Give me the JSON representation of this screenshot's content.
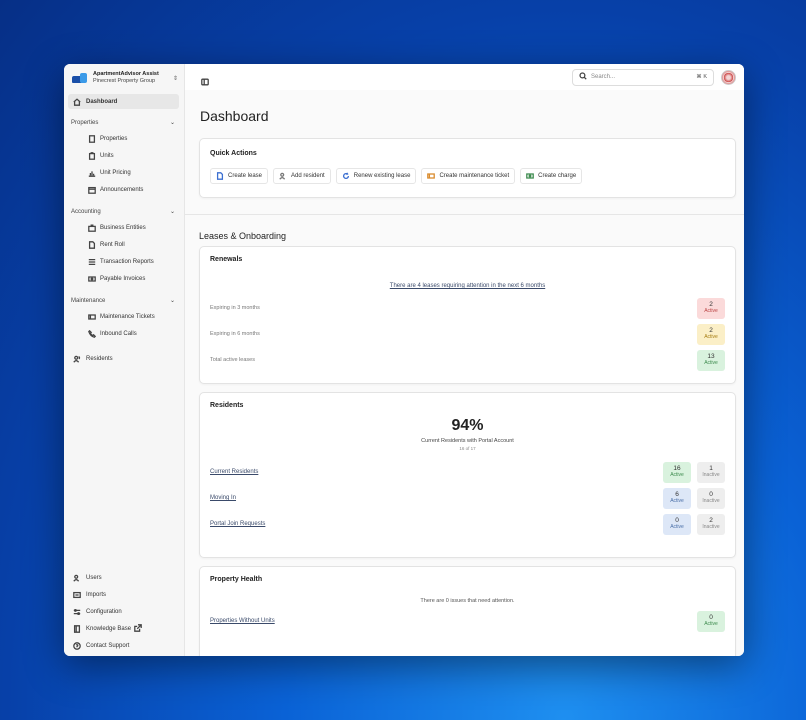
{
  "org": {
    "name": "ApartmentAdvisor Assist",
    "group": "Pinecrest Property Group"
  },
  "nav": {
    "dashboard": "Dashboard",
    "sections": [
      {
        "title": "Properties",
        "items": [
          "Properties",
          "Units",
          "Unit Pricing",
          "Announcements"
        ]
      },
      {
        "title": "Accounting",
        "items": [
          "Business Entities",
          "Rent Roll",
          "Transaction Reports",
          "Payable Invoices"
        ]
      },
      {
        "title": "Maintenance",
        "items": [
          "Maintenance Tickets",
          "Inbound Calls"
        ]
      }
    ],
    "residents": "Residents",
    "bottom": [
      "Users",
      "Imports",
      "Configuration",
      "Knowledge Base",
      "Contact Support"
    ]
  },
  "search": {
    "placeholder": "Search...",
    "shortcut": "⌘ K"
  },
  "page": {
    "title": "Dashboard"
  },
  "quick_actions": {
    "title": "Quick Actions",
    "buttons": [
      "Create lease",
      "Add resident",
      "Renew existing lease",
      "Create maintenance ticket",
      "Create charge"
    ]
  },
  "leases_section": {
    "title": "Leases & Onboarding"
  },
  "renewals": {
    "title": "Renewals",
    "alert": "There are 4 leases requiring attention in the next 6 months",
    "rows": [
      {
        "label": "Expiring in 3 months",
        "value": "2",
        "status": "Active"
      },
      {
        "label": "Expiring in 6 months",
        "value": "2",
        "status": "Active"
      },
      {
        "label": "Total active leases",
        "value": "13",
        "status": "Active"
      }
    ]
  },
  "residents_card": {
    "title": "Residents",
    "percent": "94%",
    "caption": "Current Residents with Portal Account",
    "sub": "16 of 17",
    "rows": [
      {
        "label": "Current Residents",
        "a": "16",
        "a_status": "Active",
        "b": "1",
        "b_status": "Inactive"
      },
      {
        "label": "Moving In",
        "a": "6",
        "a_status": "Active",
        "b": "0",
        "b_status": "Inactive"
      },
      {
        "label": "Portal Join Requests",
        "a": "0",
        "a_status": "Active",
        "b": "2",
        "b_status": "Inactive"
      }
    ]
  },
  "health": {
    "title": "Property Health",
    "message": "There are 0 issues that need attention.",
    "rows": [
      {
        "label": "Properties Without Units",
        "value": "0",
        "status": "Active"
      }
    ]
  }
}
